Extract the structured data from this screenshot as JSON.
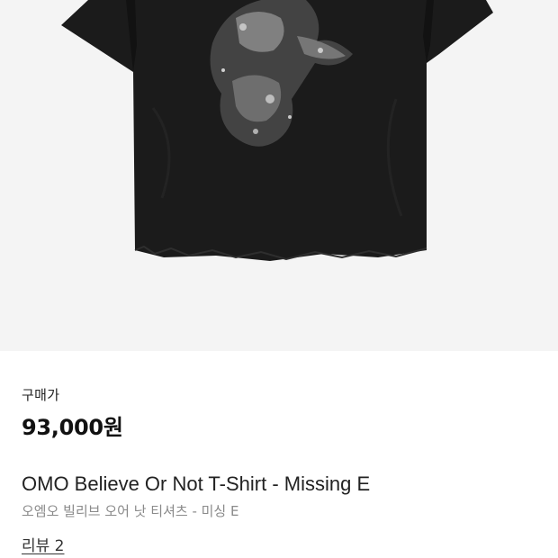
{
  "product": {
    "image_alt": "black graphic t-shirt",
    "price_label": "구매가",
    "price": "93,000원",
    "title_en": "OMO Believe Or Not T-Shirt - Missing E",
    "title_ko": "오엠오 빌리브 오어 낫 티셔츠 - 미싱 E",
    "review_link": "리뷰 2"
  },
  "colors": {
    "image_bg": "#f4f4f4",
    "shirt": "#1b1b1b",
    "text_primary": "#222222",
    "text_secondary": "#8a8a8a"
  }
}
